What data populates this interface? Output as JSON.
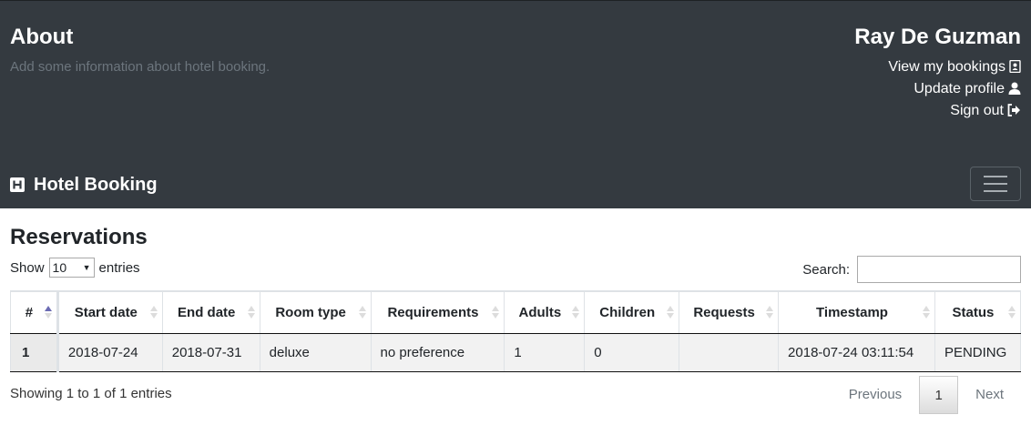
{
  "header": {
    "about_title": "About",
    "about_description": "Add some information about hotel booking.",
    "user_name": "Ray De Guzman",
    "user_links": [
      {
        "label": "View my bookings",
        "icon": "address-book-icon"
      },
      {
        "label": "Update profile",
        "icon": "user-icon"
      },
      {
        "label": "Sign out",
        "icon": "sign-out-icon"
      }
    ]
  },
  "navbar": {
    "brand": "Hotel Booking",
    "brand_icon": "hospital-h-icon",
    "toggler_icon": "hamburger-icon"
  },
  "main": {
    "title": "Reservations",
    "length": {
      "prefix": "Show",
      "value": "10",
      "suffix": "entries"
    },
    "search_label": "Search:",
    "search_value": "",
    "table": {
      "columns": [
        "#",
        "Start date",
        "End date",
        "Room type",
        "Requirements",
        "Adults",
        "Children",
        "Requests",
        "Timestamp",
        "Status"
      ],
      "rows": [
        [
          "1",
          "2018-07-24",
          "2018-07-31",
          "deluxe",
          "no preference",
          "1",
          "0",
          "",
          "2018-07-24 03:11:54",
          "PENDING"
        ]
      ]
    },
    "info": "Showing 1 to 1 of 1 entries",
    "pagination": {
      "previous": "Previous",
      "current": "1",
      "next": "Next"
    }
  },
  "colors": {
    "header_bg": "#343a40",
    "muted": "#6c757d",
    "sort_active": "#6b6bb3"
  }
}
